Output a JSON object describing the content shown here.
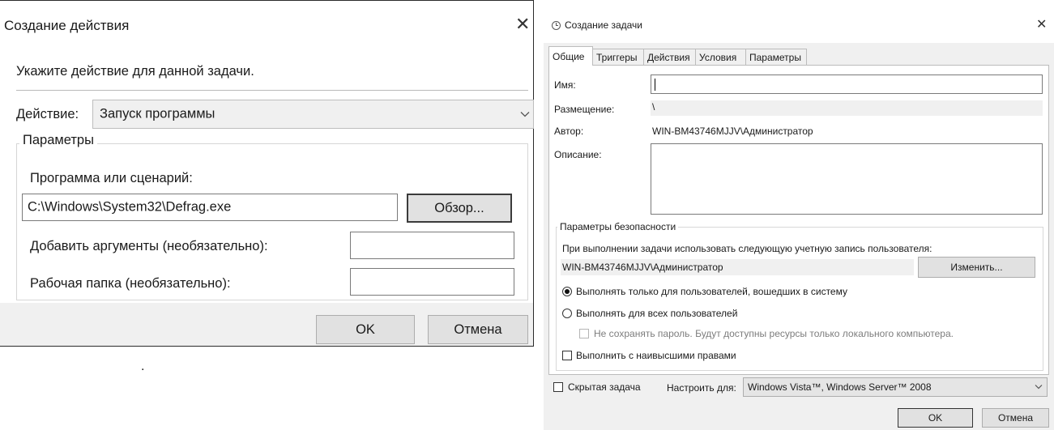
{
  "action_dialog": {
    "title": "Создание действия",
    "instruction": "Укажите действие для данной задачи.",
    "action_label": "Действие:",
    "action_value": "Запуск программы",
    "params_group": "Параметры",
    "program_label": "Программа или сценарий:",
    "program_value": "C:\\Windows\\System32\\Defrag.exe",
    "browse_button": "Обзор...",
    "args_label": "Добавить аргументы (необязательно):",
    "args_value": "",
    "workdir_label": "Рабочая папка (необязательно):",
    "workdir_value": "",
    "ok_button": "OK",
    "cancel_button": "Отмена",
    "stray_dot": "."
  },
  "task_dialog": {
    "title": "Создание задачи",
    "tabs": [
      "Общие",
      "Триггеры",
      "Действия",
      "Условия",
      "Параметры"
    ],
    "active_tab": 0,
    "general": {
      "name_label": "Имя:",
      "name_value": "",
      "location_label": "Размещение:",
      "location_value": "\\",
      "author_label": "Автор:",
      "author_value": "WIN-BM43746MJJV\\Администратор",
      "description_label": "Описание:",
      "description_value": ""
    },
    "security": {
      "group_title": "Параметры безопасности",
      "account_prompt": "При выполнении задачи использовать следующую учетную запись пользователя:",
      "account_value": "WIN-BM43746MJJV\\Администратор",
      "change_button": "Изменить...",
      "radio_logged_on": "Выполнять только для пользователей, вошедших в систему",
      "radio_logged_on_selected": true,
      "radio_all_users": "Выполнять для всех пользователей",
      "radio_all_users_selected": false,
      "no_save_password": "Не сохранять пароль. Будут доступны ресурсы только локального компьютера.",
      "no_save_password_checked": false,
      "highest_privileges": "Выполнить с наивысшими правами",
      "highest_privileges_checked": false
    },
    "hidden_label": "Скрытая задача",
    "hidden_checked": false,
    "configure_label": "Настроить для:",
    "configure_value": "Windows Vista™, Windows Server™ 2008",
    "ok_button": "OK",
    "cancel_button": "Отмена"
  }
}
